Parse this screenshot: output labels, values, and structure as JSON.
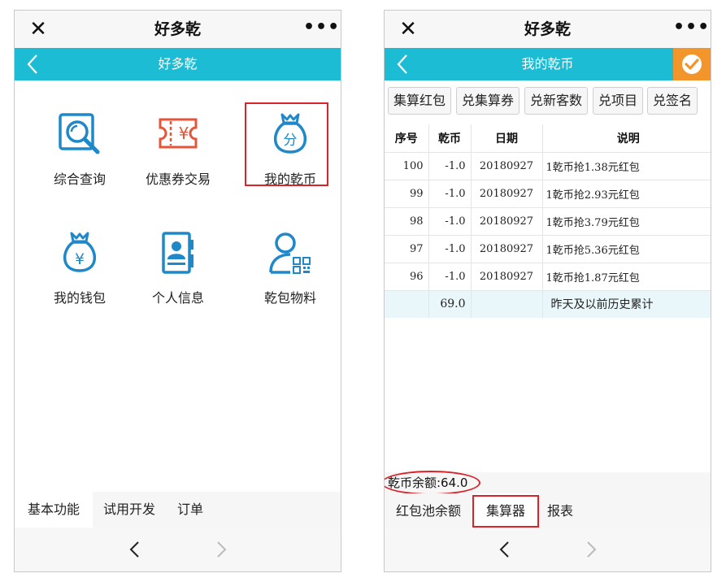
{
  "left": {
    "titlebar": {
      "title": "好多乾",
      "close_glyph": "✕",
      "more_glyph": "•••"
    },
    "navbar": {
      "title": "好多乾"
    },
    "tiles": [
      {
        "label": "综合查询",
        "icon": "magnifier-icon"
      },
      {
        "label": "优惠券交易",
        "icon": "coupon-ticket-icon"
      },
      {
        "label": "我的乾币",
        "icon": "money-bag-fen-icon",
        "highlighted": true
      },
      {
        "label": "我的钱包",
        "icon": "money-bag-yuan-icon"
      },
      {
        "label": "个人信息",
        "icon": "id-card-icon"
      },
      {
        "label": "乾包物料",
        "icon": "person-qr-icon"
      }
    ],
    "tabs": [
      {
        "label": "基本功能",
        "active": true
      },
      {
        "label": "试用开发",
        "active": false
      },
      {
        "label": "订单",
        "active": false
      }
    ]
  },
  "right": {
    "titlebar": {
      "title": "好多乾",
      "close_glyph": "✕",
      "more_glyph": "•••"
    },
    "navbar": {
      "title": "我的乾币"
    },
    "buttons": [
      "集算红包",
      "兑集算券",
      "兑新客数",
      "兑项目",
      "兑签名"
    ],
    "table": {
      "headers": [
        "序号",
        "乾币",
        "日期",
        "说明"
      ],
      "rows": [
        {
          "no": "100",
          "coin": "-1.0",
          "date": "20180927",
          "desc": "1乾币抢1.38元红包"
        },
        {
          "no": "99",
          "coin": "-1.0",
          "date": "20180927",
          "desc": "1乾币抢2.93元红包"
        },
        {
          "no": "98",
          "coin": "-1.0",
          "date": "20180927",
          "desc": "1乾币抢3.79元红包"
        },
        {
          "no": "97",
          "coin": "-1.0",
          "date": "20180927",
          "desc": "1乾币抢5.36元红包"
        },
        {
          "no": "96",
          "coin": "-1.0",
          "date": "20180927",
          "desc": "1乾币抢1.87元红包"
        }
      ],
      "summary": {
        "no": "",
        "coin": "69.0",
        "date": "",
        "desc": "昨天及以前历史累计"
      }
    },
    "balance": "乾币余额:64.0",
    "tabs": [
      {
        "label": "红包池余额",
        "active": false
      },
      {
        "label": "集算器",
        "active": true
      },
      {
        "label": "报表",
        "active": false
      }
    ]
  },
  "colors": {
    "nav_bg": "#1cbcd4",
    "icon_blue": "#1e88c9",
    "icon_red": "#e4553a",
    "check_orange": "#f2952b",
    "highlight_red": "#d9242a"
  }
}
